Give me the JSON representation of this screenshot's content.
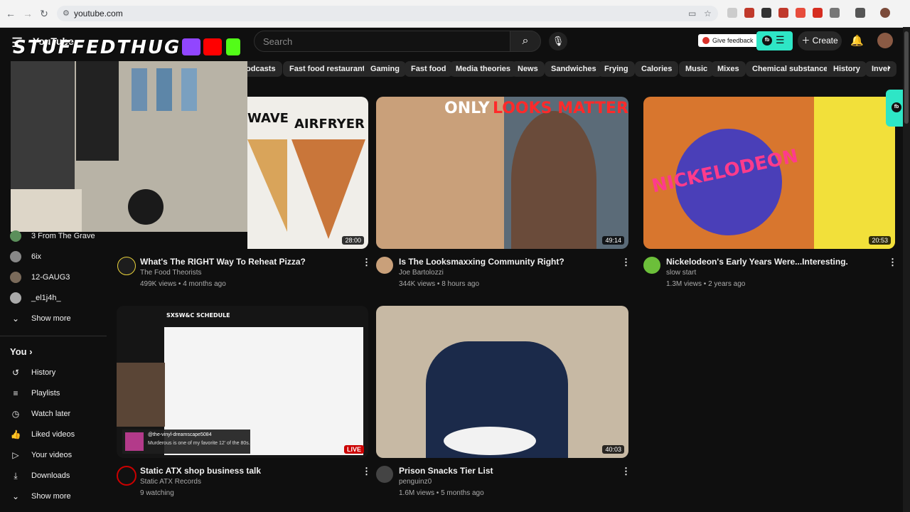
{
  "browser": {
    "url": "youtube.com"
  },
  "header": {
    "logo": "YouTube",
    "search_placeholder": "Search",
    "feedback": "Give feedback",
    "create": "Create",
    "fb_label": "fb"
  },
  "overlay": {
    "title": "STUFFEDTHUG"
  },
  "chips": [
    "odcasts",
    "Fast food restaurants",
    "Gaming",
    "Fast food",
    "Media theories",
    "News",
    "Sandwiches",
    "Frying",
    "Calories",
    "Music",
    "Mixes",
    "Chemical substances",
    "History",
    "Inver"
  ],
  "sidebar": {
    "subscriptions": [
      "3 From The Grave",
      "6ix",
      "12-GAUG3",
      "_el1j4h_"
    ],
    "show_more": "Show more",
    "you": "You",
    "you_items": [
      "History",
      "Playlists",
      "Watch later",
      "Liked videos",
      "Your videos",
      "Downloads"
    ],
    "show_more_2": "Show more"
  },
  "videos": [
    {
      "title": "What's The RIGHT Way To Reheat Pizza?",
      "channel": "The Food Theorists",
      "meta": "499K views • 4 months ago",
      "duration": "28:00",
      "thumb_text_1": "WAVE",
      "thumb_text_2": "AIRFRYER"
    },
    {
      "title": "Is The Looksmaxxing Community Right?",
      "channel": "Joe Bartolozzi",
      "meta": "344K views • 8 hours ago",
      "duration": "49:14",
      "thumb_text_1": "ONLY",
      "thumb_text_2": "LOOKS MATTER"
    },
    {
      "title": "Nickelodeon's Early Years Were...Interesting.",
      "channel": "slow start",
      "meta": "1.3M views • 2 years ago",
      "duration": "20:53",
      "thumb_text_1": "NICKELODEON"
    },
    {
      "title": "Static ATX shop business talk",
      "channel": "Static ATX Records",
      "meta": "9 watching",
      "live": "LIVE",
      "thumb_text_1": "SXSW&C SCHEDULE",
      "chat_user": "@the-vinyl-dreamscape5084",
      "chat_msg": "Murderous is one of my favorite 12' of the 80s."
    },
    {
      "title": "Prison Snacks Tier List",
      "channel": "penguinz0",
      "meta": "1.6M views • 5 months ago",
      "duration": "40:03"
    }
  ]
}
